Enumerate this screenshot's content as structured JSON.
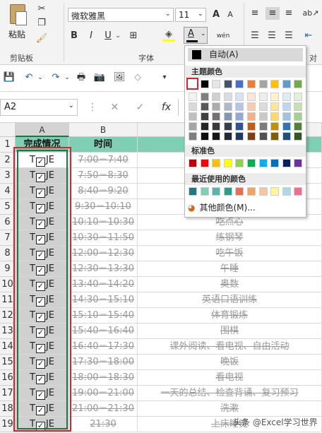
{
  "ribbon": {
    "paste_label": "粘贴",
    "clipboard_label": "剪贴板",
    "font_group_label": "字体",
    "font_name": "微软雅黑",
    "font_size": "11",
    "bold": "B",
    "italic": "I",
    "underline": "U",
    "font_color_letter": "A",
    "wen_label": "wén",
    "align_label": "对",
    "grow_font": "A",
    "shrink_font": "A"
  },
  "formula_bar": {
    "name_box": "A2",
    "fx": "fx"
  },
  "columns": [
    "A",
    "B"
  ],
  "header_row": {
    "row": "1",
    "a": "完成情况",
    "b": "时间",
    "c": ""
  },
  "rows": [
    {
      "row": "2",
      "a1": "T",
      "a2": "JE",
      "time": "7:00－7:40",
      "task": ""
    },
    {
      "row": "3",
      "a1": "T",
      "a2": "JE",
      "time": "7:50－8:30",
      "task": ""
    },
    {
      "row": "4",
      "a1": "T",
      "a2": "JE",
      "time": "8:40－9:20",
      "task": ""
    },
    {
      "row": "5",
      "a1": "T",
      "a2": "JE",
      "time": "9:30－10:10",
      "task": ""
    },
    {
      "row": "6",
      "a1": "T",
      "a2": "JE",
      "time": "10:10－10:30",
      "task": "吃点心"
    },
    {
      "row": "7",
      "a1": "T",
      "a2": "JE",
      "time": "10:30－11:50",
      "task": "练钢琴"
    },
    {
      "row": "8",
      "a1": "T",
      "a2": "JE",
      "time": "12:00－12:30",
      "task": "吃午饭"
    },
    {
      "row": "9",
      "a1": "T",
      "a2": "JE",
      "time": "12:30－13:30",
      "task": "午睡"
    },
    {
      "row": "10",
      "a1": "T",
      "a2": "JE",
      "time": "13:40－14:20",
      "task": "奥数"
    },
    {
      "row": "11",
      "a1": "T",
      "a2": "JE",
      "time": "14:30－15:10",
      "task": "英语口语训练"
    },
    {
      "row": "12",
      "a1": "T",
      "a2": "JE",
      "time": "15:10－15:40",
      "task": "体育锻炼"
    },
    {
      "row": "13",
      "a1": "T",
      "a2": "JE",
      "time": "15:40－16:40",
      "task": "围棋"
    },
    {
      "row": "14",
      "a1": "T",
      "a2": "JE",
      "time": "16:40－17:30",
      "task": "课外阅读、看电视、自由活动"
    },
    {
      "row": "15",
      "a1": "T",
      "a2": "JE",
      "time": "17:30－18:00",
      "task": "晚饭"
    },
    {
      "row": "16",
      "a1": "T",
      "a2": "JE",
      "time": "18:00－18:30",
      "task": "看电视"
    },
    {
      "row": "17",
      "a1": "T",
      "a2": "JE",
      "time": "19:00－21:00",
      "task": "一天的总结、检查背诵、复习预习"
    },
    {
      "row": "18",
      "a1": "T",
      "a2": "JE",
      "time": "21:00－21:30",
      "task": "洗漱"
    },
    {
      "row": "19",
      "a1": "T",
      "a2": "JE",
      "time": "21:30",
      "task": "上床睡觉"
    }
  ],
  "color_picker": {
    "auto_label": "自动(A)",
    "theme_label": "主题颜色",
    "standard_label": "标准色",
    "recent_label": "最近使用的颜色",
    "more_label": "其他颜色(M)...",
    "theme_top": [
      "#ffffff",
      "#000000",
      "#e7e6e6",
      "#44546a",
      "#4472c4",
      "#ed7d31",
      "#a5a5a5",
      "#ffc000",
      "#5b9bd5",
      "#70ad47"
    ],
    "theme_shades": [
      [
        "#f2f2f2",
        "#7f7f7f",
        "#d0cece",
        "#d6dce4",
        "#d9e2f3",
        "#fbe5d6",
        "#ededed",
        "#fff2cc",
        "#deebf6",
        "#e2efd9"
      ],
      [
        "#d9d9d9",
        "#595959",
        "#aeabab",
        "#adb9ca",
        "#b4c6e7",
        "#f8cbad",
        "#dbdbdb",
        "#ffe599",
        "#bdd7ee",
        "#c5e0b3"
      ],
      [
        "#bfbfbf",
        "#404040",
        "#757171",
        "#8497b0",
        "#8eaadb",
        "#f4b183",
        "#c9c9c9",
        "#ffd966",
        "#9cc3e5",
        "#a8d08d"
      ],
      [
        "#a6a6a6",
        "#262626",
        "#3a3838",
        "#333f4f",
        "#2f5496",
        "#c55a11",
        "#7b7b7b",
        "#bf8f00",
        "#2e75b5",
        "#538135"
      ],
      [
        "#7f7f7f",
        "#0d0d0d",
        "#171616",
        "#222a35",
        "#1f3864",
        "#833c0b",
        "#525252",
        "#7f6000",
        "#1e4e79",
        "#375623"
      ]
    ],
    "standard": [
      "#c00000",
      "#ff0000",
      "#ffc000",
      "#ffff00",
      "#92d050",
      "#00b050",
      "#00b0f0",
      "#0070c0",
      "#002060",
      "#7030a0"
    ],
    "recent": [
      "#1f7a80",
      "#7ecfb3",
      "#5ab4ac",
      "#2a9d8f",
      "#e76f51",
      "#f4a261",
      "#f7c59f",
      "#fff59d",
      "#a8d8ea",
      "#ef6f8a"
    ]
  },
  "watermark": "头条 @Excel学习世界",
  "accent_color": "#217346",
  "highlight_red": "#e0202c"
}
